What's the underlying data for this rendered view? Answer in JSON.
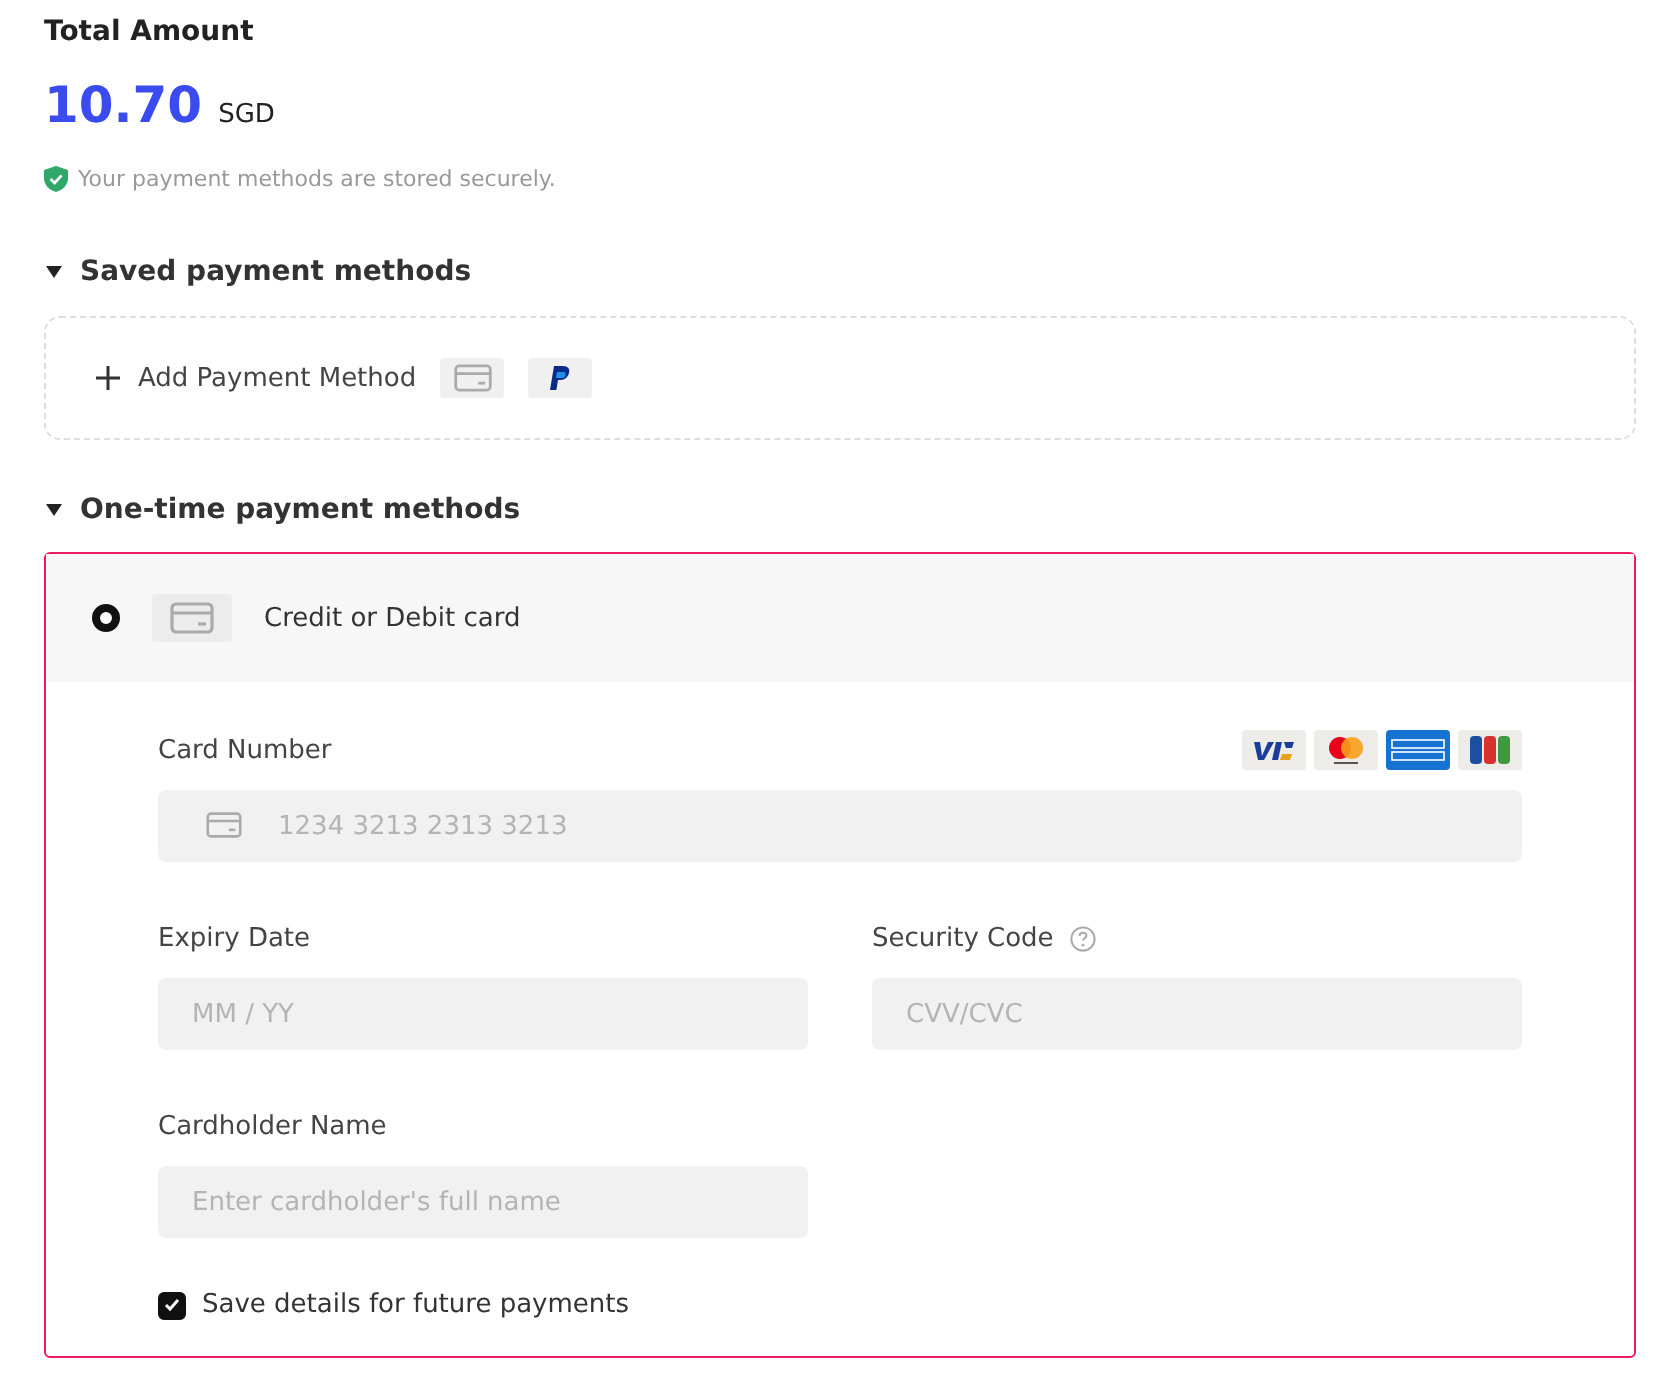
{
  "total": {
    "label": "Total Amount",
    "amount": "10.70",
    "currency": "SGD"
  },
  "security_note": "Your payment methods are stored securely.",
  "saved_section": {
    "title": "Saved payment methods",
    "expanded": true,
    "add_button": "Add Payment Method"
  },
  "onetime_section": {
    "title": "One-time payment methods",
    "expanded": true,
    "methods": [
      {
        "label": "Credit or Debit card",
        "selected": true
      }
    ]
  },
  "card_form": {
    "card_number": {
      "label": "Card Number",
      "placeholder": "1234 3213 2313 3213"
    },
    "expiry": {
      "label": "Expiry Date",
      "placeholder": "MM / YY"
    },
    "security_code": {
      "label": "Security Code",
      "placeholder": "CVV/CVC"
    },
    "cardholder": {
      "label": "Cardholder Name",
      "placeholder": "Enter cardholder's full name"
    },
    "save_details": {
      "label": "Save details for future payments",
      "checked": true
    }
  }
}
